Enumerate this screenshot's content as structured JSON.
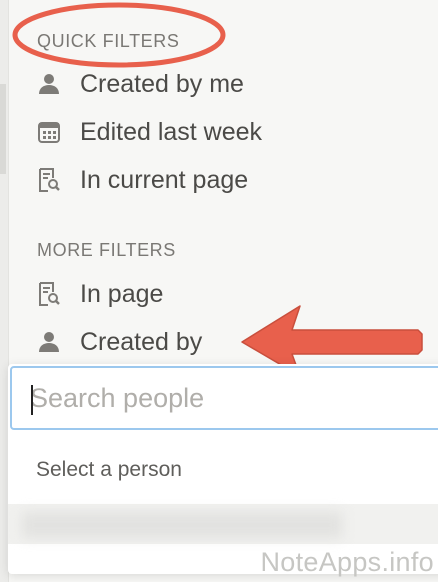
{
  "quick_filters": {
    "title": "QUICK FILTERS",
    "items": [
      {
        "label": "Created by me",
        "icon": "person-icon"
      },
      {
        "label": "Edited last week",
        "icon": "calendar-icon"
      },
      {
        "label": "In current page",
        "icon": "page-search-icon"
      }
    ]
  },
  "more_filters": {
    "title": "MORE FILTERS",
    "items": [
      {
        "label": "In page",
        "icon": "page-search-icon"
      },
      {
        "label": "Created by",
        "icon": "person-icon"
      }
    ]
  },
  "people_popover": {
    "search_placeholder": "Search people",
    "search_value": "",
    "hint": "Select a person"
  },
  "watermark": "NoteApps.info",
  "colors": {
    "annotation": "#e8604c",
    "focus_ring": "#9cc8ee",
    "icon": "#7d7b77",
    "text": "#4b4a47",
    "section_title": "#7a7874"
  }
}
